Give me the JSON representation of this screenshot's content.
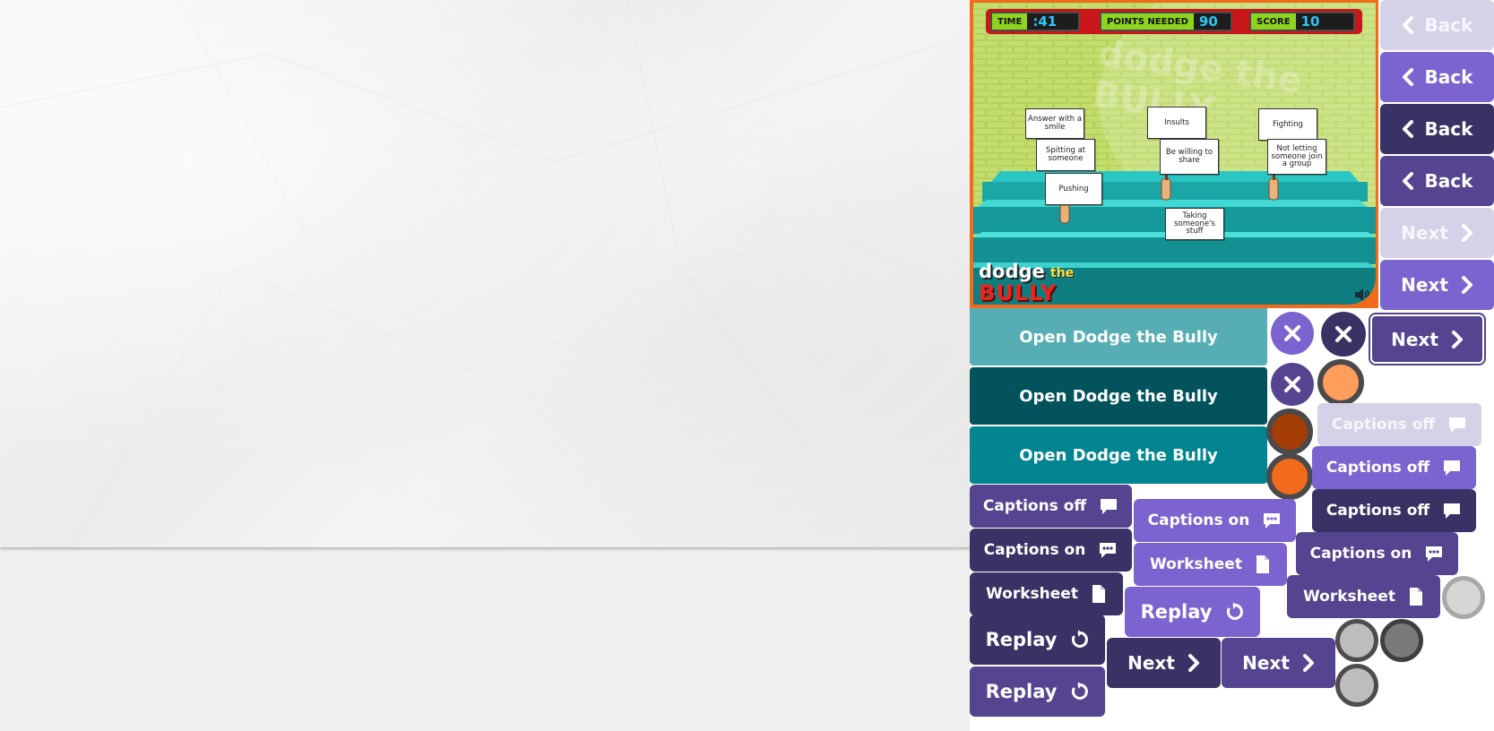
{
  "game": {
    "hud": {
      "time_label": "TIME",
      "time_value": ":41",
      "points_label": "POINTS NEEDED",
      "points_value": "90",
      "score_label": "SCORE",
      "score_value": "10"
    },
    "signs": [
      "Answer with a smile",
      "Spitting at someone",
      "Pushing",
      "Insults",
      "Be willing to share",
      "Fighting",
      "Not letting someone join a group",
      "Taking someone's stuff"
    ],
    "logo": {
      "line1": "dodge",
      "line2": "the",
      "line3": "BULLY"
    },
    "watermark": "dodge the BULLY",
    "sound_icon": "speaker-icon"
  },
  "buttons": {
    "back": "Back",
    "next": "Next",
    "open": "Open Dodge the Bully",
    "captions_off": "Captions off",
    "captions_on": "Captions on",
    "worksheet": "Worksheet",
    "replay": "Replay"
  },
  "colors": {
    "light": "#d5d2e8",
    "medium": "#7b64cf",
    "dark": "#3a3265",
    "mid_dark": "#55448f",
    "teal_light": "#56aeb4",
    "teal_dark": "#02535c",
    "teal": "#028590",
    "orange": "#f26a1b"
  }
}
